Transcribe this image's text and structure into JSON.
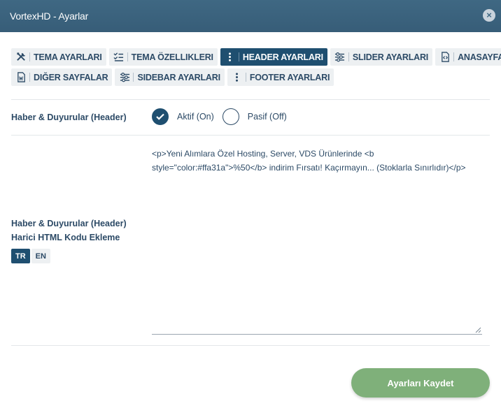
{
  "window": {
    "title": "VortexHD - Ayarlar",
    "close_label": "×"
  },
  "tabs": {
    "row1": [
      {
        "label": "TEMA AYARLARI",
        "icon": "tools-icon",
        "active": false
      },
      {
        "label": "TEMA ÖZELLIKLERI",
        "icon": "checklist-icon",
        "active": false
      },
      {
        "label": "HEADER AYARLARI",
        "icon": "vertical-dots-icon",
        "active": true
      },
      {
        "label": "SLIDER AYARLARI",
        "icon": "sliders-icon",
        "active": false
      },
      {
        "label": "ANASAYFA",
        "icon": "code-file-icon",
        "active": false
      }
    ],
    "row2": [
      {
        "label": "DIĞER SAYFALAR",
        "icon": "word-file-icon",
        "active": false
      },
      {
        "label": "SIDEBAR AYARLARI",
        "icon": "sliders-icon",
        "active": false
      },
      {
        "label": "FOOTER AYARLARI",
        "icon": "vertical-dots-icon",
        "active": false
      }
    ]
  },
  "news_toggle": {
    "label": "Haber & Duyurular (Header)",
    "options": [
      {
        "label": "Aktif (On)",
        "checked": true
      },
      {
        "label": "Pasif (Off)",
        "checked": false
      }
    ]
  },
  "html_code": {
    "label_line1": "Haber & Duyurular (Header)",
    "label_line2": "Harici HTML Kodu Ekleme",
    "languages": [
      {
        "code": "TR",
        "active": true
      },
      {
        "code": "EN",
        "active": false
      }
    ],
    "value": "<p>Yeni Alımlara Özel Hosting, Server, VDS Ürünlerinde <b style=\"color:#ffa31a\">%50</b> indirim Fırsatı! Kaçırmayın... (Stoklarla Sınırlıdır)</p>"
  },
  "footer": {
    "save_label": "Ayarları Kaydet"
  },
  "colors": {
    "header": "#3f6883",
    "active_tab": "#1f4f70",
    "save_button": "#7fb07a"
  }
}
